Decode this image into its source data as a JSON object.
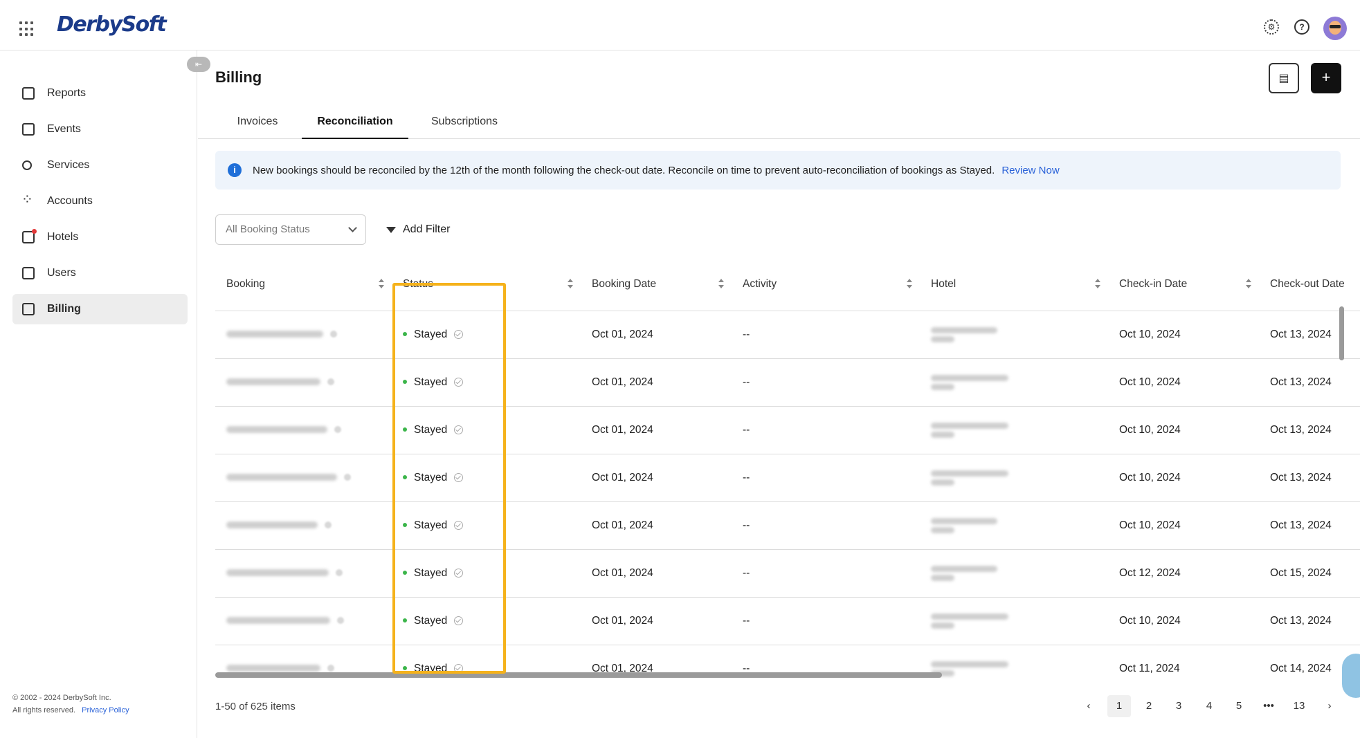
{
  "app": {
    "logo": "DerbySoft"
  },
  "sidebar": {
    "items": [
      {
        "label": "Reports",
        "icon": "reports-icon"
      },
      {
        "label": "Events",
        "icon": "calendar-icon"
      },
      {
        "label": "Services",
        "icon": "services-icon"
      },
      {
        "label": "Accounts",
        "icon": "accounts-icon"
      },
      {
        "label": "Hotels",
        "icon": "hotel-icon"
      },
      {
        "label": "Users",
        "icon": "users-icon"
      },
      {
        "label": "Billing",
        "icon": "billing-icon",
        "active": true
      }
    ],
    "footer": {
      "copyright": "© 2002 - 2024 DerbySoft Inc.",
      "rights": "All rights reserved.",
      "privacy": "Privacy Policy"
    }
  },
  "page": {
    "title": "Billing",
    "tabs": [
      {
        "label": "Invoices"
      },
      {
        "label": "Reconciliation",
        "active": true
      },
      {
        "label": "Subscriptions"
      }
    ]
  },
  "alert": {
    "message": "New bookings should be reconciled by the 12th of the month following the check-out date. Reconcile on time to prevent auto-reconciliation of bookings as Stayed.",
    "link": "Review Now"
  },
  "filters": {
    "status_select": "All Booking Status",
    "add_filter": "Add Filter"
  },
  "table": {
    "columns": [
      "Booking",
      "Status",
      "Booking Date",
      "Activity",
      "Hotel",
      "Check-in Date",
      "Check-out Date"
    ],
    "rows": [
      {
        "status": "Stayed",
        "booking_date": "Oct 01, 2024",
        "activity": "--",
        "checkin": "Oct 10, 2024",
        "checkout": "Oct 13, 2024"
      },
      {
        "status": "Stayed",
        "booking_date": "Oct 01, 2024",
        "activity": "--",
        "checkin": "Oct 10, 2024",
        "checkout": "Oct 13, 2024"
      },
      {
        "status": "Stayed",
        "booking_date": "Oct 01, 2024",
        "activity": "--",
        "checkin": "Oct 10, 2024",
        "checkout": "Oct 13, 2024"
      },
      {
        "status": "Stayed",
        "booking_date": "Oct 01, 2024",
        "activity": "--",
        "checkin": "Oct 10, 2024",
        "checkout": "Oct 13, 2024"
      },
      {
        "status": "Stayed",
        "booking_date": "Oct 01, 2024",
        "activity": "--",
        "checkin": "Oct 10, 2024",
        "checkout": "Oct 13, 2024"
      },
      {
        "status": "Stayed",
        "booking_date": "Oct 01, 2024",
        "activity": "--",
        "checkin": "Oct 12, 2024",
        "checkout": "Oct 15, 2024"
      },
      {
        "status": "Stayed",
        "booking_date": "Oct 01, 2024",
        "activity": "--",
        "checkin": "Oct 10, 2024",
        "checkout": "Oct 13, 2024"
      },
      {
        "status": "Stayed",
        "booking_date": "Oct 01, 2024",
        "activity": "--",
        "checkin": "Oct 11, 2024",
        "checkout": "Oct 14, 2024"
      }
    ]
  },
  "pagination": {
    "summary": "1-50 of 625 items",
    "pages": [
      "1",
      "2",
      "3",
      "4",
      "5",
      "•••",
      "13"
    ],
    "current": "1",
    "prev": "‹",
    "next": "›"
  },
  "colors": {
    "highlight": "#f5b21b",
    "status_dot": "#3bb54a",
    "link": "#2a62d8",
    "alert_bg": "#eef4fb"
  }
}
